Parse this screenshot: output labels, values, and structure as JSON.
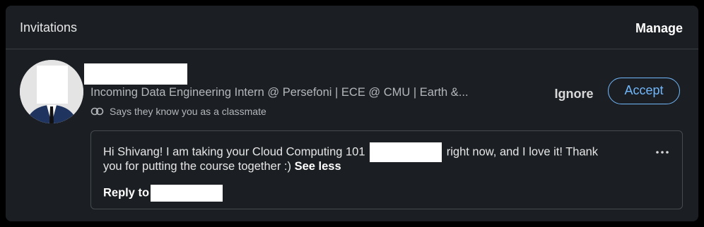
{
  "header": {
    "title": "Invitations",
    "manage_label": "Manage"
  },
  "invitation": {
    "headline": "Incoming Data Engineering Intern @ Persefoni | ECE @ CMU | Earth &...",
    "insight": "Says they know you as a classmate",
    "ignore_label": "Ignore",
    "accept_label": "Accept",
    "message": {
      "line1_a": "Hi Shivang! I am taking your Cloud Computing 101",
      "line1_b": "right now, and I love it! Thank",
      "line2": "you for putting the course together :)",
      "see_less": "See less",
      "reply_label": "Reply to"
    }
  },
  "icons": {
    "insight": "mutual-connections-icon",
    "more": "more-options-icon"
  },
  "colors": {
    "background": "#000000",
    "card": "#1b1f23",
    "accent": "#71b7fb",
    "muted_text": "#b4b7ba"
  }
}
